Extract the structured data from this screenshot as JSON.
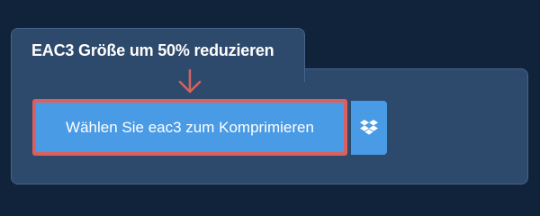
{
  "card": {
    "tab_title": "EAC3 Größe um 50% reduzieren"
  },
  "upload": {
    "button_label": "Wählen Sie eac3 zum Komprimieren",
    "dropbox_icon": "dropbox-icon"
  },
  "colors": {
    "page_background": "#11233a",
    "panel_background": "#2d4a6d",
    "button_blue": "#4a9be6",
    "highlight_red": "#d9605c"
  }
}
